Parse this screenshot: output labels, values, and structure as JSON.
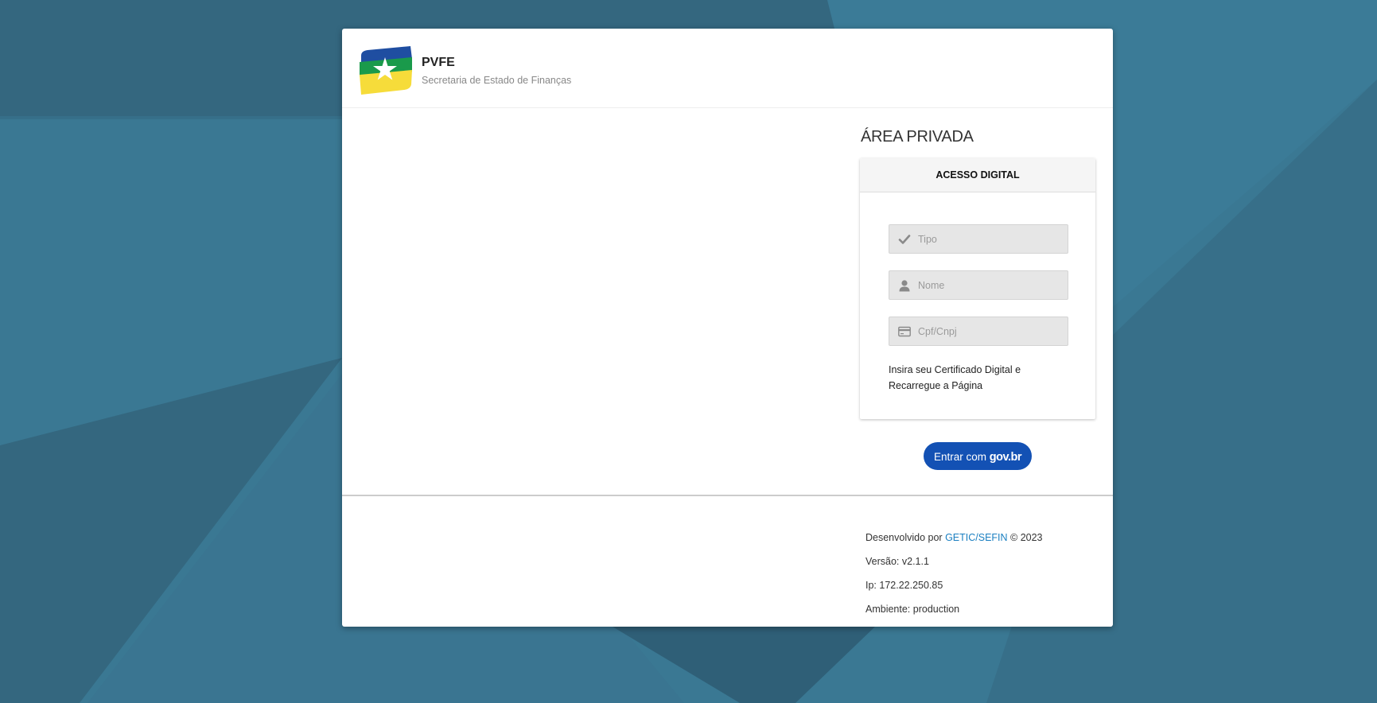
{
  "header": {
    "title": "PVFE",
    "subtitle": "Secretaria de Estado de Finanças"
  },
  "main": {
    "section_title": "ÁREA PRIVADA",
    "panel": {
      "heading": "ACESSO DIGITAL",
      "fields": [
        {
          "placeholder": "Tipo",
          "icon": "check-icon"
        },
        {
          "placeholder": "Nome",
          "icon": "user-icon"
        },
        {
          "placeholder": "Cpf/Cnpj",
          "icon": "credit-card-icon"
        }
      ],
      "note": "Insira seu Certificado Digital e Recarregue a Página"
    },
    "govbr_button": {
      "prefix": "Entrar com ",
      "brand": "gov.br"
    }
  },
  "footer": {
    "dev_prefix": "Desenvolvido por ",
    "dev_link": "GETIC/SEFIN",
    "dev_suffix": " © 2023",
    "version": "Versão: v2.1.1",
    "ip": "Ip: 172.22.250.85",
    "environment": "Ambiente: production"
  },
  "colors": {
    "background": "#3a7893",
    "govbr_blue": "#1351b4",
    "link": "#1a7fc1",
    "logo_blue": "#1f4ea1",
    "logo_green": "#1a9a4b",
    "logo_yellow": "#f6dc3a"
  }
}
